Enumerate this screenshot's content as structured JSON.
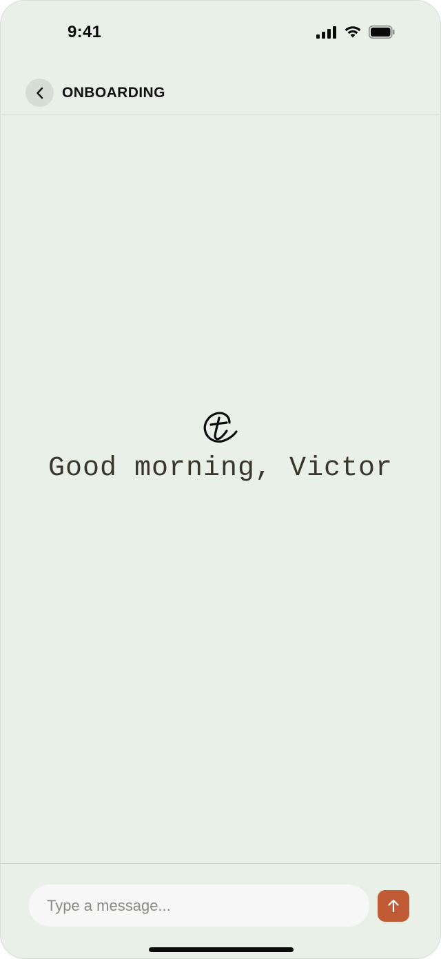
{
  "status_bar": {
    "time": "9:41",
    "icons": [
      "cellular-signal-icon",
      "wifi-icon",
      "battery-icon"
    ]
  },
  "header": {
    "back_icon": "chevron-left-icon",
    "title": "ONBOARDING"
  },
  "main": {
    "logo_icon": "brand-logo-icon",
    "greeting": "Good morning, Victor"
  },
  "composer": {
    "placeholder": "Type a message...",
    "value": "",
    "send_icon": "arrow-up-icon"
  },
  "colors": {
    "background": "#e8f0e8",
    "accent": "#c05b36",
    "text": "#3a362c"
  }
}
